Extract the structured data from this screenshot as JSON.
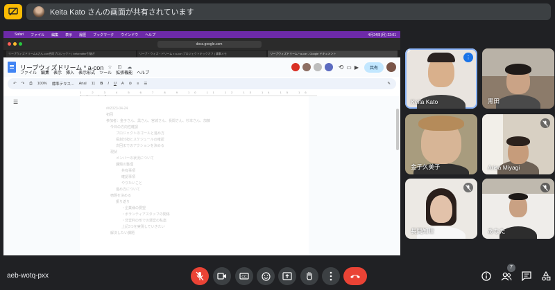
{
  "banner": {
    "presenter_text": "Keita Kato さんの画面が共有されています"
  },
  "shared_screen": {
    "mac_menu": [
      "Safari",
      "ファイル",
      "編集",
      "表示",
      "履歴",
      "ブックマーク",
      "ウインドウ",
      "ヘルプ"
    ],
    "mac_clock": "4月24日(月) 22:01",
    "url": "docs.google.com",
    "tabs": [
      "リーブウィズドリーム&さん-con合同プロジェクト | beforeafter引継ぎ",
      "リーブ・ウィズ・ドリーム x a-con プロジェクトキックオフ | 議事メモ",
      "リーブウィズドリーム * a-con - Google ドキュメント"
    ],
    "doc_title": "リーブウィズドリーム * a-con",
    "doc_menu": [
      "ファイル",
      "編集",
      "表示",
      "挿入",
      "表示形式",
      "ツール",
      "拡張機能",
      "ヘルプ"
    ],
    "share_button": "共有",
    "toolbar": {
      "zoom": "100%",
      "style": "標準テキス...",
      "font": "Arial",
      "size": "11"
    },
    "ruler": "1 2 3 4 5 6 7 8 9 10 11 12 13 14 15 16 17 18",
    "doc_lines": [
      {
        "text": "##2023-04-24",
        "indent": 0
      },
      {
        "text": "初回",
        "indent": 0
      },
      {
        "text": "参加者：金子さん、黒さん、宮城さん、長間さん、杉本さん、加藤",
        "indent": 0
      },
      {
        "text": "今日の方向性確認",
        "indent": 1
      },
      {
        "text": "プロジェクトのゴールと進め方",
        "indent": 2
      },
      {
        "text": "役割分担とスケジュールの確認",
        "indent": 2
      },
      {
        "text": "次回までのアクションを決める",
        "indent": 2
      },
      {
        "text": "現状",
        "indent": 1
      },
      {
        "text": "メンバーの状況について",
        "indent": 2
      },
      {
        "text": "課題の整理",
        "indent": 2
      },
      {
        "text": "共有事項",
        "indent": 3
      },
      {
        "text": "確認事項",
        "indent": 3
      },
      {
        "text": "やりたいこと",
        "indent": 3
      },
      {
        "text": "進め方について",
        "indent": 2
      },
      {
        "text": "宿題を決める",
        "indent": 1
      },
      {
        "text": "振り返り",
        "indent": 2
      },
      {
        "text": "・企業様の要望",
        "indent": 3
      },
      {
        "text": "・ボランティアスタッフの関係",
        "indent": 3
      },
      {
        "text": "・非営利の形での運営の私案",
        "indent": 3
      },
      {
        "text": "上記3つを実現していきたい",
        "indent": 3
      },
      {
        "text": "解決したい課題",
        "indent": 1
      }
    ]
  },
  "participants": [
    {
      "name": "Keita Kato",
      "tag": "tP",
      "speaking": true,
      "muted": false
    },
    {
      "name": "黒田",
      "tag": "",
      "speaking": false,
      "muted": false
    },
    {
      "name": "金子久美子",
      "tag": "",
      "speaking": false,
      "muted": false
    },
    {
      "name": "Arisa Miyagi",
      "tag": "",
      "speaking": false,
      "muted": true
    },
    {
      "name": "長間知世",
      "tag": "",
      "speaking": false,
      "muted": true
    },
    {
      "name": "あなた",
      "tag": "",
      "speaking": false,
      "muted": true
    }
  ],
  "bottom": {
    "meeting_code": "aeb-wotq-pxx",
    "participant_count": "7"
  },
  "colors": {
    "background": "#202124",
    "control": "#3c4043",
    "danger": "#ea4335",
    "presenting": "#fbbc04",
    "speaking_outline": "#8ab4f8"
  }
}
